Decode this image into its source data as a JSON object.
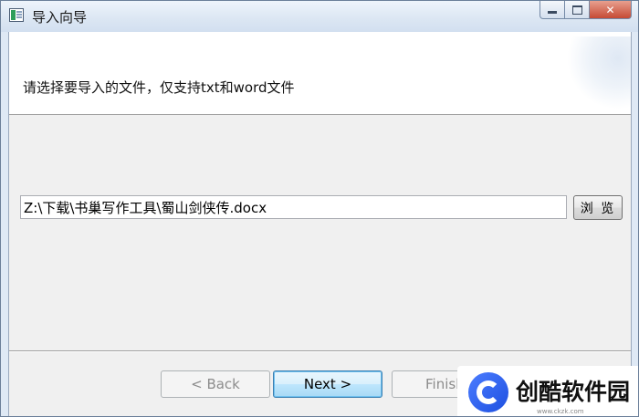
{
  "window": {
    "title": "导入向导"
  },
  "header": {
    "instruction": "请选择要导入的文件，仅支持txt和word文件"
  },
  "file": {
    "path": "Z:\\下载\\书巢写作工具\\蜀山剑侠传.docx",
    "browse_label": "浏 览"
  },
  "nav": {
    "back_label": "< Back",
    "next_label": "Next >",
    "finish_label": "Finish"
  },
  "watermark": {
    "brand": "创酷软件园",
    "url": "www.ckzk.com"
  }
}
